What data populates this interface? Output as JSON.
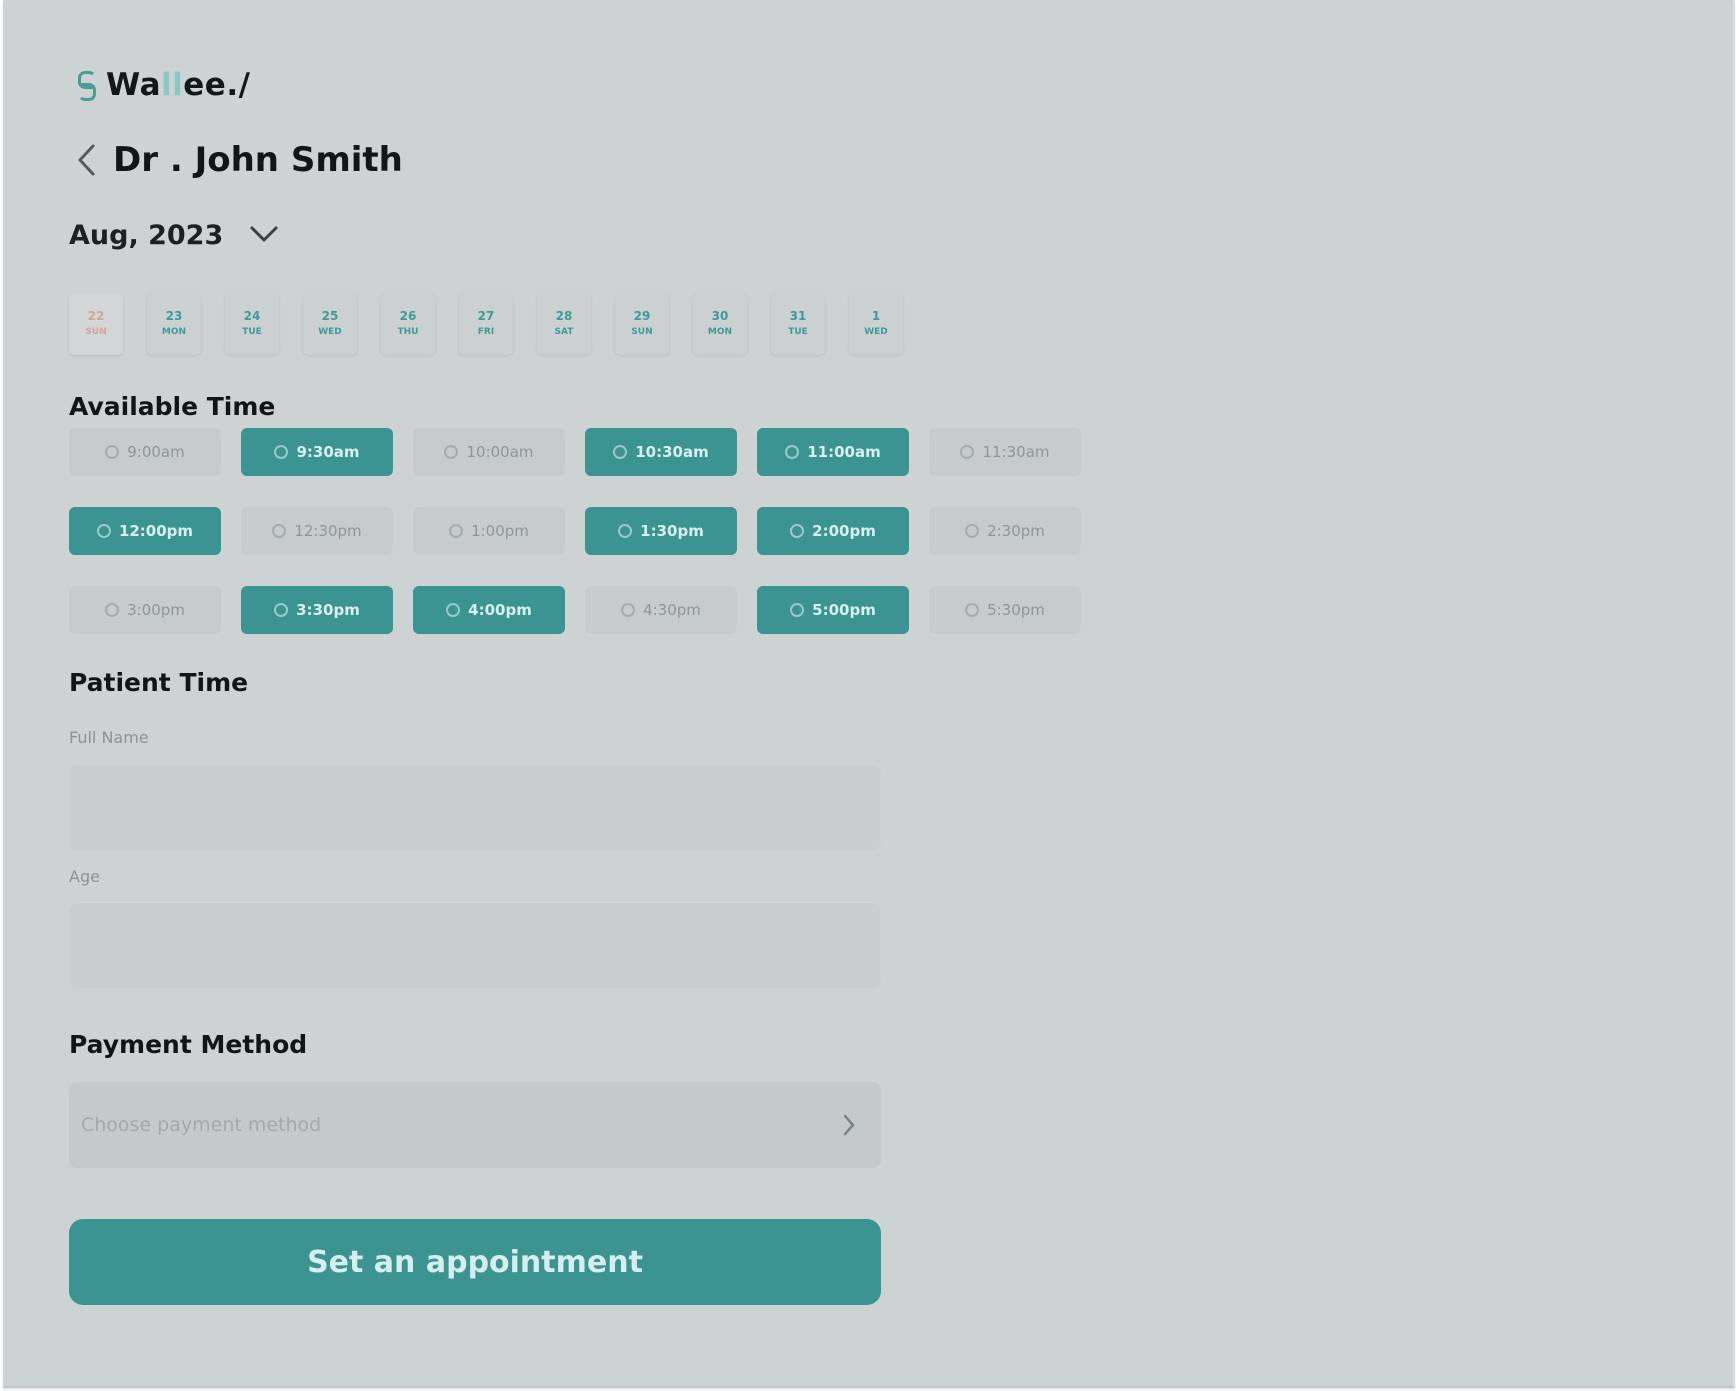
{
  "brand": {
    "name_prefix": "Wa",
    "name_highlight": "ll",
    "name_suffix": "ee./"
  },
  "header": {
    "doctor_name": "Dr . John Smith"
  },
  "calendar": {
    "month_label": "Aug, 2023",
    "dates": [
      {
        "num": "22",
        "day": "SUN",
        "disabled": true
      },
      {
        "num": "23",
        "day": "MON"
      },
      {
        "num": "24",
        "day": "TUE"
      },
      {
        "num": "25",
        "day": "WED"
      },
      {
        "num": "26",
        "day": "THU"
      },
      {
        "num": "27",
        "day": "FRI"
      },
      {
        "num": "28",
        "day": "SAT"
      },
      {
        "num": "29",
        "day": "SUN"
      },
      {
        "num": "30",
        "day": "MON"
      },
      {
        "num": "31",
        "day": "TUE"
      },
      {
        "num": "1",
        "day": "WED"
      }
    ]
  },
  "available_time": {
    "title": "Available Time",
    "slots": [
      {
        "label": "9:00am",
        "available": false
      },
      {
        "label": "9:30am",
        "available": true
      },
      {
        "label": "10:00am",
        "available": false
      },
      {
        "label": "10:30am",
        "available": true
      },
      {
        "label": "11:00am",
        "available": true
      },
      {
        "label": "11:30am",
        "available": false
      },
      {
        "label": "12:00pm",
        "available": true
      },
      {
        "label": "12:30pm",
        "available": false
      },
      {
        "label": "1:00pm",
        "available": false
      },
      {
        "label": "1:30pm",
        "available": true
      },
      {
        "label": "2:00pm",
        "available": true
      },
      {
        "label": "2:30pm",
        "available": false
      },
      {
        "label": "3:00pm",
        "available": false
      },
      {
        "label": "3:30pm",
        "available": true
      },
      {
        "label": "4:00pm",
        "available": true
      },
      {
        "label": "4:30pm",
        "available": false
      },
      {
        "label": "5:00pm",
        "available": true
      },
      {
        "label": "5:30pm",
        "available": false
      }
    ]
  },
  "patient": {
    "title": "Patient Time",
    "full_name_label": "Full Name",
    "full_name_value": "",
    "age_label": "Age",
    "age_value": ""
  },
  "payment": {
    "title": "Payment Method",
    "placeholder": "Choose payment method"
  },
  "cta": {
    "label": "Set an appointment"
  },
  "colors": {
    "accent": "#3b9491",
    "background": "#cdd3d3",
    "slot_inactive": "#c6cccc",
    "disabled_date": "#d3a39d"
  },
  "icons": {
    "back": "chevron-left-icon",
    "month_dropdown": "chevron-down-icon",
    "payment_chevron": "chevron-right-icon",
    "slot_clock": "clock-icon",
    "logo": "brand-logo-icon"
  }
}
